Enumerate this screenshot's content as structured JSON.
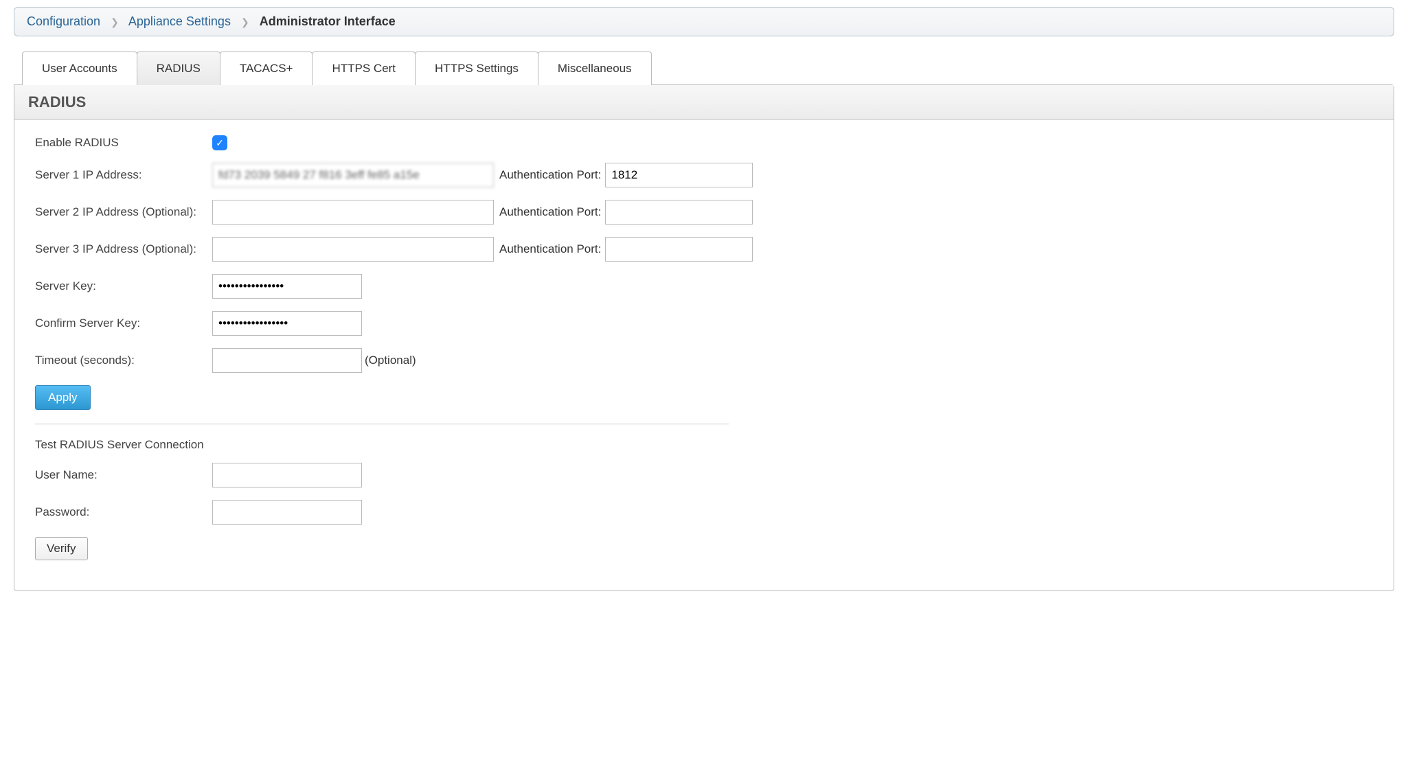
{
  "breadcrumb": {
    "items": [
      "Configuration",
      "Appliance Settings"
    ],
    "current": "Administrator Interface"
  },
  "tabs": {
    "items": [
      "User Accounts",
      "RADIUS",
      "TACACS+",
      "HTTPS Cert",
      "HTTPS Settings",
      "Miscellaneous"
    ],
    "active_index": 1
  },
  "panel": {
    "title": "RADIUS"
  },
  "form": {
    "enable_label": "Enable RADIUS",
    "enable_checked": true,
    "server1_label": "Server 1 IP Address:",
    "server1_value": "fd73 2039 5849 27 f816 3eff fe85 a15e",
    "server2_label": "Server 2 IP Address (Optional):",
    "server2_value": "",
    "server3_label": "Server 3 IP Address (Optional):",
    "server3_value": "",
    "auth_port_label": "Authentication Port:",
    "auth_port1": "1812",
    "auth_port2": "",
    "auth_port3": "",
    "server_key_label": "Server Key:",
    "server_key_value": "••••••••••••••••",
    "confirm_key_label": "Confirm Server Key:",
    "confirm_key_value": "•••••••••••••••••",
    "timeout_label": "Timeout (seconds):",
    "timeout_value": "",
    "timeout_optional": "(Optional)",
    "apply_label": "Apply"
  },
  "test": {
    "header": "Test RADIUS Server Connection",
    "username_label": "User Name:",
    "username_value": "",
    "password_label": "Password:",
    "password_value": "",
    "verify_label": "Verify"
  }
}
